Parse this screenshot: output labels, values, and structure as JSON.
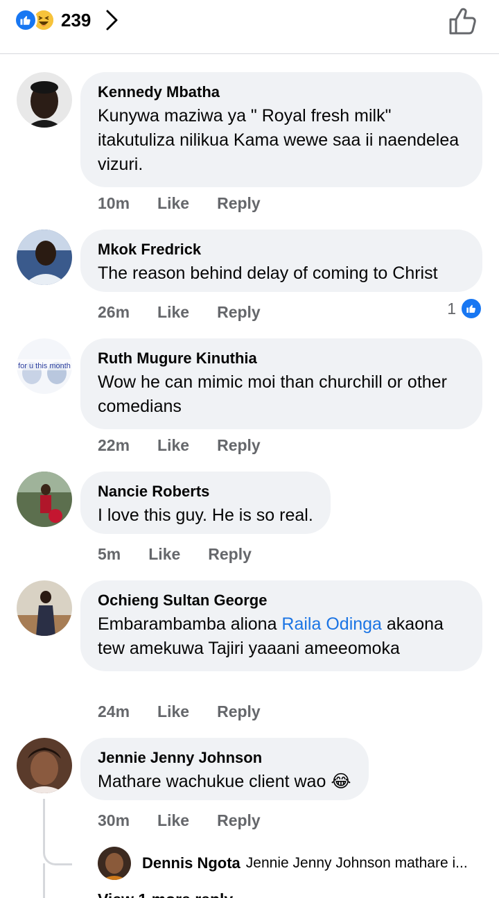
{
  "header": {
    "reaction_count": "239",
    "reaction_icons": [
      "like-reaction-icon",
      "haha-reaction-icon"
    ],
    "chevron_icon": "chevron-right-icon",
    "like_icon": "thumbs-up-outline-icon"
  },
  "colors": {
    "accent": "#1877f2",
    "bubble": "#f0f2f5",
    "meta_text": "#65676b",
    "mention": "#1b74e4"
  },
  "comments": [
    {
      "author": "Kennedy Mbatha",
      "text": "Kunywa maziwa ya \" Royal fresh milk\" itakutuliza nilikua Kama wewe saa ii naendelea vizuri.",
      "time": "10m",
      "like": "Like",
      "reply": "Reply"
    },
    {
      "author": "Mkok Fredrick",
      "text": "The reason behind delay of coming to Christ",
      "time": "26m",
      "like": "Like",
      "reply": "Reply",
      "reaction_count": "1"
    },
    {
      "author": "Ruth Mugure Kinuthia",
      "text": "Wow he can mimic moi than churchill or other comedians",
      "time": "22m",
      "like": "Like",
      "reply": "Reply",
      "avatar_text": "for u this month"
    },
    {
      "author": "Nancie Roberts",
      "text": "I love this guy. He is so real.",
      "time": "5m",
      "like": "Like",
      "reply": "Reply"
    },
    {
      "author": "Ochieng Sultan George",
      "text_before": "Embarambamba aliona ",
      "mention": "Raila Odinga",
      "text_after": " akaona tew amekuwa Tajiri yaaani ameeomoka",
      "time": "24m",
      "like": "Like",
      "reply": "Reply"
    },
    {
      "author": "Jennie Jenny Johnson",
      "text": "Mathare wachukue client wao",
      "emoji": "😂",
      "time": "30m",
      "like": "Like",
      "reply": "Reply"
    }
  ],
  "reply_preview": {
    "author": "Dennis Ngota",
    "snippet": "Jennie Jenny Johnson mathare i...",
    "view_more": "View 1 more reply"
  }
}
